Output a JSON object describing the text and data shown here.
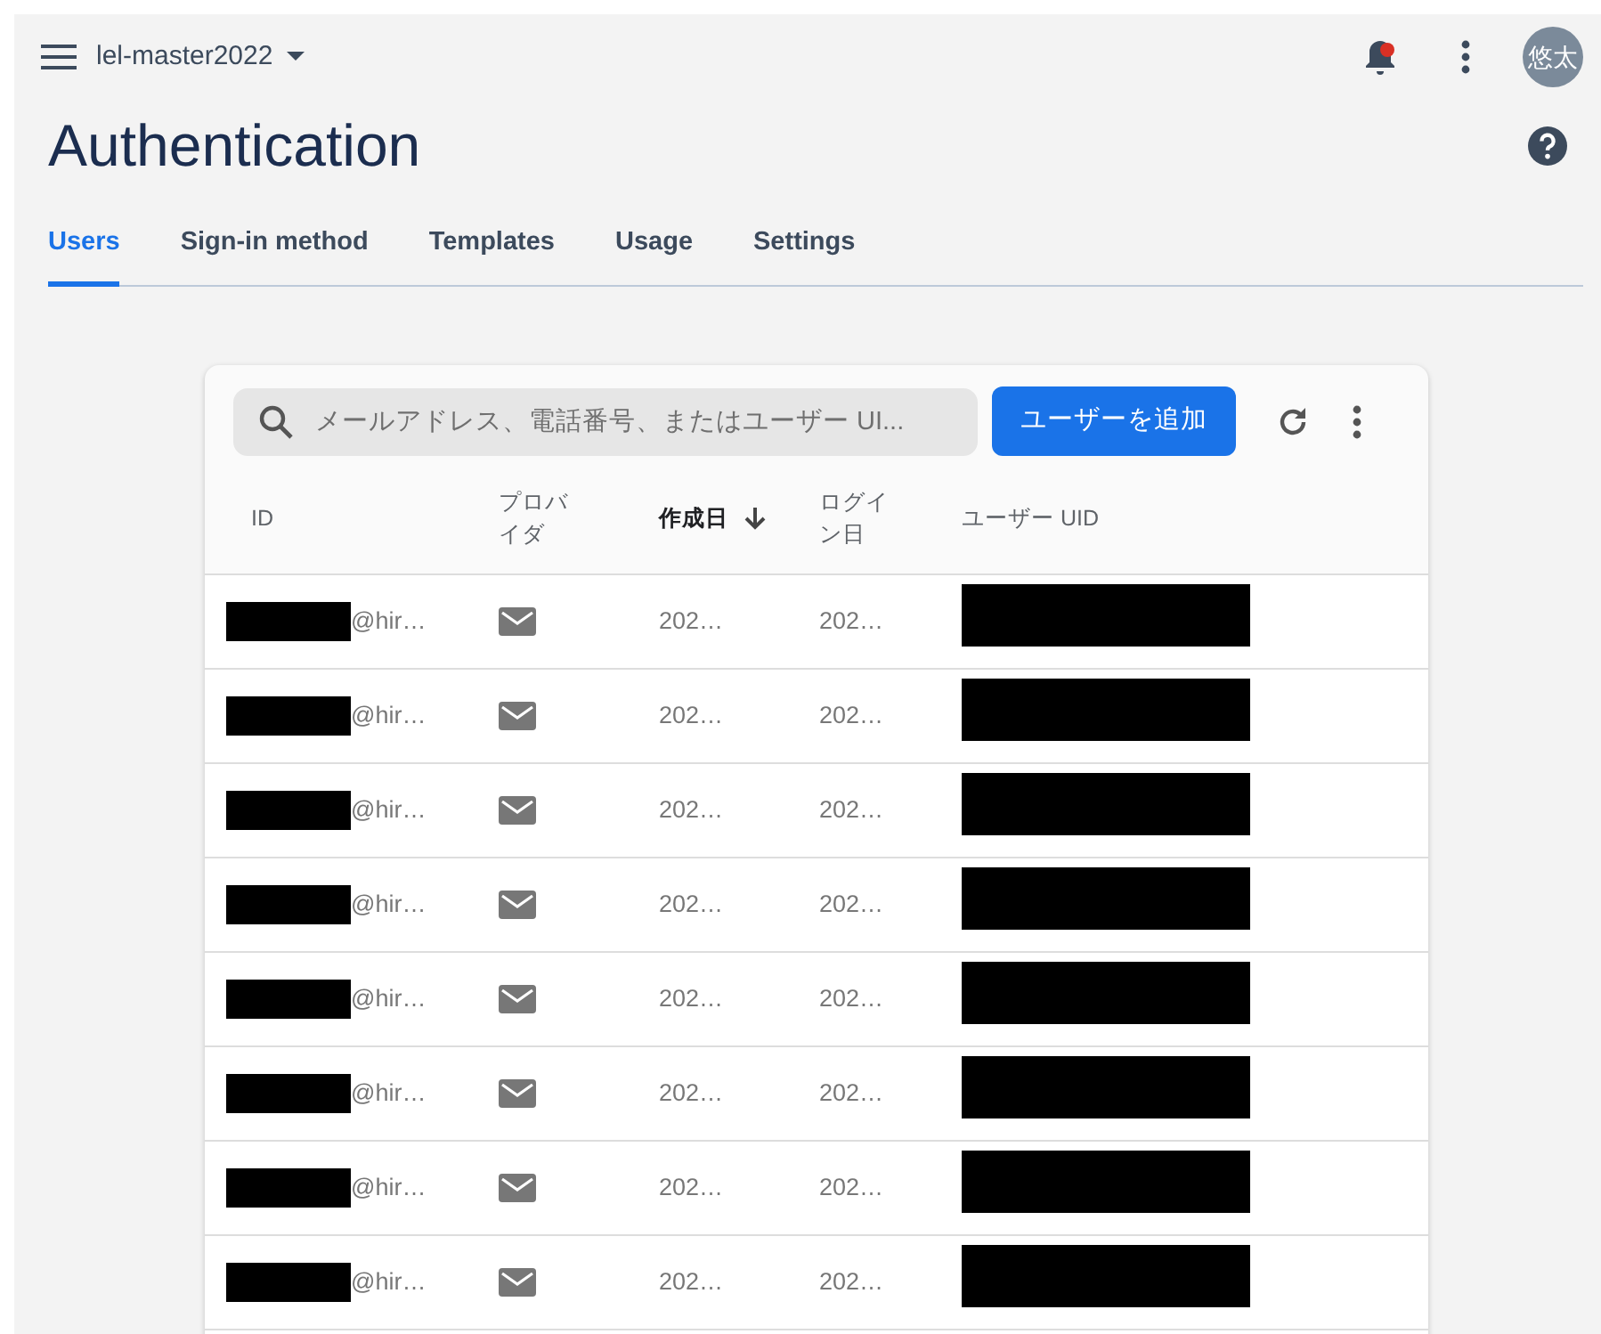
{
  "topbar": {
    "project": "lel-master2022",
    "avatar": "悠太",
    "has_notification": true
  },
  "page": {
    "title": "Authentication"
  },
  "tabs": [
    {
      "label": "Users",
      "selected": true
    },
    {
      "label": "Sign-in method",
      "selected": false
    },
    {
      "label": "Templates",
      "selected": false
    },
    {
      "label": "Usage",
      "selected": false
    },
    {
      "label": "Settings",
      "selected": false
    }
  ],
  "search": {
    "placeholder": "メールアドレス、電話番号、またはユーザー UI..."
  },
  "add_button": "ユーザーを追加",
  "table": {
    "columns": [
      {
        "label": "ID",
        "sorted": false
      },
      {
        "label": "プロバイダ",
        "sorted": false
      },
      {
        "label": "作成日",
        "sorted": true
      },
      {
        "label": "ログイン日",
        "sorted": false
      },
      {
        "label": "ユーザー UID",
        "sorted": false
      }
    ],
    "rows": [
      {
        "id": "@hir…",
        "created": "202…",
        "signed_in": "202…"
      },
      {
        "id": "@hir…",
        "created": "202…",
        "signed_in": "202…"
      },
      {
        "id": "@hir…",
        "created": "202…",
        "signed_in": "202…"
      },
      {
        "id": "@hir…",
        "created": "202…",
        "signed_in": "202…"
      },
      {
        "id": "@hir…",
        "created": "202…",
        "signed_in": "202…"
      },
      {
        "id": "@hir…",
        "created": "202…",
        "signed_in": "202…"
      },
      {
        "id": "@hir…",
        "created": "202…",
        "signed_in": "202…"
      },
      {
        "id": "@hir…",
        "created": "202…",
        "signed_in": "202…"
      }
    ]
  }
}
